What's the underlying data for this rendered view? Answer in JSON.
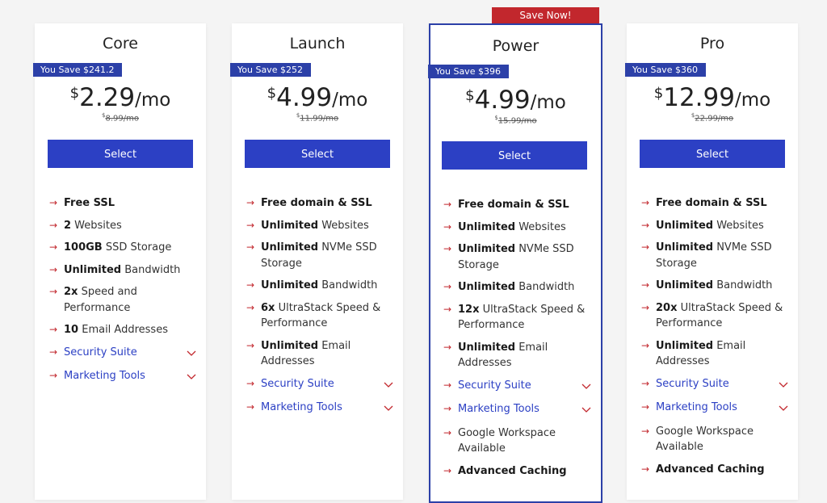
{
  "save_now": "Save Now!",
  "colors": {
    "accent": "#2c40c4",
    "badge": "#2c40a8",
    "sale": "#c2272d"
  },
  "icons": {
    "bullet": "arrow-right-icon",
    "expand": "chevron-down-icon"
  },
  "plans": [
    {
      "title": "Core",
      "badge": "You Save $241.2",
      "currency": "$",
      "price": "2.29",
      "per": "/mo",
      "old_currency": "$",
      "old_price": "8.99/mo",
      "select_label": "Select",
      "features": [
        {
          "bold": "Free SSL",
          "text": ""
        },
        {
          "bold": "2",
          "text": " Websites"
        },
        {
          "bold": "100GB",
          "text": " SSD Storage"
        },
        {
          "bold": "Unlimited",
          "text": " Bandwidth"
        },
        {
          "bold": "2x",
          "text": " Speed and Performance"
        },
        {
          "bold": "10",
          "text": " Email Addresses"
        }
      ],
      "expandables": [
        "Security Suite",
        "Marketing Tools"
      ],
      "extras": []
    },
    {
      "title": "Launch",
      "badge": "You Save $252",
      "currency": "$",
      "price": "4.99",
      "per": "/mo",
      "old_currency": "$",
      "old_price": "11.99/mo",
      "select_label": "Select",
      "features": [
        {
          "bold": "Free domain & SSL",
          "text": ""
        },
        {
          "bold": "Unlimited",
          "text": " Websites"
        },
        {
          "bold": "Unlimited",
          "text": " NVMe SSD Storage"
        },
        {
          "bold": "Unlimited",
          "text": " Bandwidth"
        },
        {
          "bold": "6x",
          "text": " UltraStack Speed & Performance"
        },
        {
          "bold": "Unlimited",
          "text": " Email Addresses"
        }
      ],
      "expandables": [
        "Security Suite",
        "Marketing Tools"
      ],
      "extras": []
    },
    {
      "title": "Power",
      "badge": "You Save $396",
      "currency": "$",
      "price": "4.99",
      "per": "/mo",
      "old_currency": "$",
      "old_price": "15.99/mo",
      "select_label": "Select",
      "features": [
        {
          "bold": "Free domain & SSL",
          "text": ""
        },
        {
          "bold": "Unlimited",
          "text": " Websites"
        },
        {
          "bold": "Unlimited",
          "text": " NVMe SSD Storage"
        },
        {
          "bold": "Unlimited",
          "text": " Bandwidth"
        },
        {
          "bold": "12x",
          "text": " UltraStack Speed & Performance"
        },
        {
          "bold": "Unlimited",
          "text": " Email Addresses"
        }
      ],
      "expandables": [
        "Security Suite",
        "Marketing Tools"
      ],
      "extras": [
        {
          "bold": "",
          "text": "Google Workspace Available"
        },
        {
          "bold": "Advanced Caching",
          "text": ""
        }
      ]
    },
    {
      "title": "Pro",
      "badge": "You Save $360",
      "currency": "$",
      "price": "12.99",
      "per": "/mo",
      "old_currency": "$",
      "old_price": "22.99/mo",
      "select_label": "Select",
      "features": [
        {
          "bold": "Free domain & SSL",
          "text": ""
        },
        {
          "bold": "Unlimited",
          "text": " Websites"
        },
        {
          "bold": "Unlimited",
          "text": " NVMe SSD Storage"
        },
        {
          "bold": "Unlimited",
          "text": " Bandwidth"
        },
        {
          "bold": "20x",
          "text": " UltraStack Speed & Performance"
        },
        {
          "bold": "Unlimited",
          "text": " Email Addresses"
        }
      ],
      "expandables": [
        "Security Suite",
        "Marketing Tools"
      ],
      "extras": [
        {
          "bold": "",
          "text": "Google Workspace Available"
        },
        {
          "bold": "Advanced Caching",
          "text": ""
        }
      ]
    }
  ]
}
